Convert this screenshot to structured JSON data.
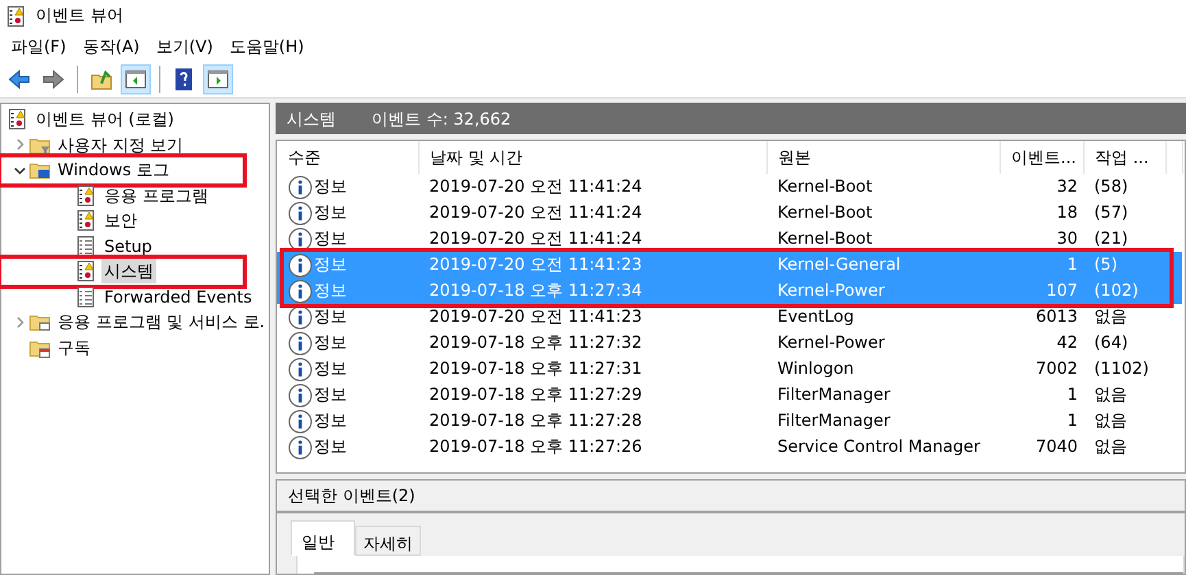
{
  "window": {
    "title": "이벤트 뷰어"
  },
  "menu": [
    "파일(F)",
    "동작(A)",
    "보기(V)",
    "도움말(H)"
  ],
  "toolbar": [
    {
      "kind": "back"
    },
    {
      "kind": "forward"
    },
    {
      "kind": "sep"
    },
    {
      "kind": "folder-up"
    },
    {
      "kind": "pane-left",
      "selected": true
    },
    {
      "kind": "sep"
    },
    {
      "kind": "help"
    },
    {
      "kind": "pane-right",
      "selected": true
    }
  ],
  "tree": [
    {
      "label": "이벤트 뷰어 (로컬)",
      "kind": "log-warn",
      "highlighted": false,
      "selected": false,
      "children": [
        {
          "label": "사용자 지정 보기",
          "kind": "folder-filter",
          "expanded": false,
          "highlighted": false,
          "selected": false
        },
        {
          "label": "Windows 로그",
          "kind": "folder-pc",
          "expanded": true,
          "highlighted": true,
          "selected": false,
          "children": [
            {
              "label": "응용 프로그램",
              "kind": "log-warn",
              "highlighted": false,
              "selected": false
            },
            {
              "label": "보안",
              "kind": "log-warn",
              "highlighted": false,
              "selected": false
            },
            {
              "label": "Setup",
              "kind": "log",
              "highlighted": false,
              "selected": false
            },
            {
              "label": "시스템",
              "kind": "log-warn",
              "highlighted": true,
              "selected": true
            },
            {
              "label": "Forwarded Events",
              "kind": "log",
              "highlighted": false,
              "selected": false
            }
          ]
        },
        {
          "label": "응용 프로그램 및 서비스 로.",
          "kind": "folder-pane",
          "expanded": false,
          "highlighted": false,
          "selected": false
        },
        {
          "label": "구독",
          "kind": "folder-cal",
          "highlighted": false,
          "selected": false
        }
      ]
    }
  ],
  "log_header": {
    "title": "시스템",
    "count": "이벤트 수: 32,662"
  },
  "table": {
    "columns": [
      "수준",
      "날짜 및 시간",
      "원본",
      "이벤트...",
      "작업 ..."
    ],
    "rows": [
      {
        "cells": [
          "정보",
          "2019-07-20 오전 11:41:24",
          "Kernel-Boot",
          "32",
          "(58)"
        ],
        "selected": false,
        "highlighted": false
      },
      {
        "cells": [
          "정보",
          "2019-07-20 오전 11:41:24",
          "Kernel-Boot",
          "18",
          "(57)"
        ],
        "selected": false,
        "highlighted": false
      },
      {
        "cells": [
          "정보",
          "2019-07-20 오전 11:41:24",
          "Kernel-Boot",
          "30",
          "(21)"
        ],
        "selected": false,
        "highlighted": false
      },
      {
        "cells": [
          "정보",
          "2019-07-20 오전 11:41:23",
          "Kernel-General",
          "1",
          "(5)"
        ],
        "selected": true,
        "highlighted": true
      },
      {
        "cells": [
          "정보",
          "2019-07-18 오후 11:27:34",
          "Kernel-Power",
          "107",
          "(102)"
        ],
        "selected": true,
        "highlighted": true
      },
      {
        "cells": [
          "정보",
          "2019-07-20 오전 11:41:23",
          "EventLog",
          "6013",
          "없음"
        ],
        "selected": false,
        "highlighted": false
      },
      {
        "cells": [
          "정보",
          "2019-07-18 오후 11:27:32",
          "Kernel-Power",
          "42",
          "(64)"
        ],
        "selected": false,
        "highlighted": false
      },
      {
        "cells": [
          "정보",
          "2019-07-18 오후 11:27:31",
          "Winlogon",
          "7002",
          "(1102)"
        ],
        "selected": false,
        "highlighted": false
      },
      {
        "cells": [
          "정보",
          "2019-07-18 오후 11:27:29",
          "FilterManager",
          "1",
          "없음"
        ],
        "selected": false,
        "highlighted": false
      },
      {
        "cells": [
          "정보",
          "2019-07-18 오후 11:27:28",
          "FilterManager",
          "1",
          "없음"
        ],
        "selected": false,
        "highlighted": false
      },
      {
        "cells": [
          "정보",
          "2019-07-18 오후 11:27:26",
          "Service Control Manager",
          "7040",
          "없음"
        ],
        "selected": false,
        "highlighted": false
      }
    ]
  },
  "detail": {
    "title": "선택한 이벤트(2)",
    "tabs": [
      {
        "label": "일반",
        "selected": true
      },
      {
        "label": "자세히",
        "selected": false
      }
    ]
  }
}
